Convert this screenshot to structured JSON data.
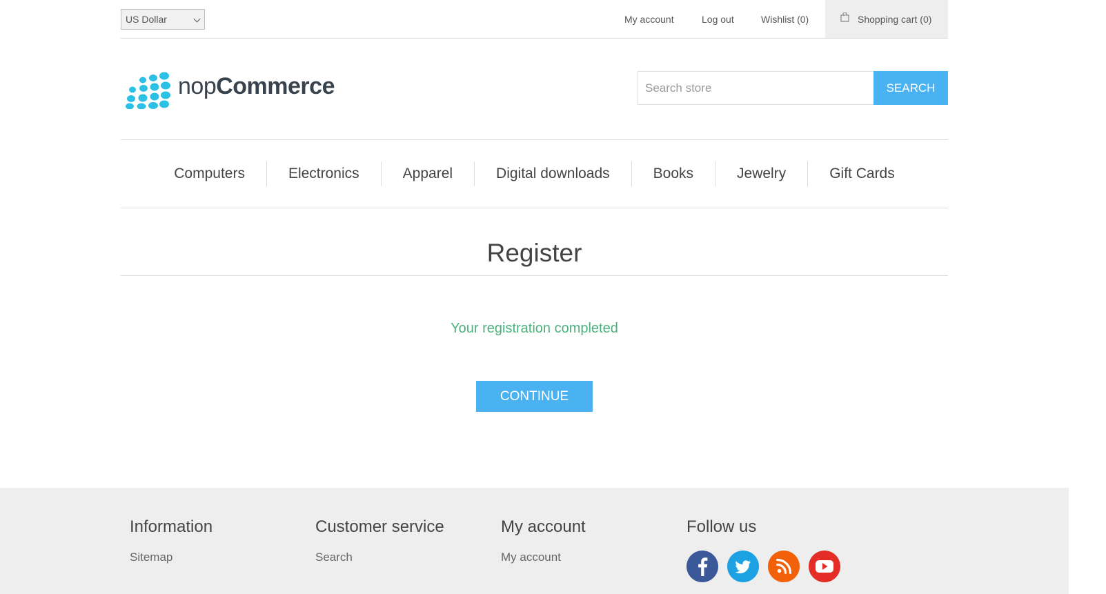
{
  "header": {
    "currency": {
      "selected": "US Dollar"
    },
    "links": {
      "my_account": "My account",
      "log_out": "Log out",
      "wishlist": "Wishlist (0)",
      "shopping_cart": "Shopping cart (0)"
    }
  },
  "logo": {
    "part1": "nop",
    "part2": "Commerce"
  },
  "search": {
    "placeholder": "Search store",
    "button": "Search"
  },
  "menu": {
    "items": [
      "Computers",
      "Electronics",
      "Apparel",
      "Digital downloads",
      "Books",
      "Jewelry",
      "Gift Cards"
    ]
  },
  "page": {
    "title": "Register",
    "result": "Your registration completed",
    "continue": "Continue"
  },
  "footer": {
    "information": {
      "title": "Information",
      "first_link": "Sitemap"
    },
    "customer_service": {
      "title": "Customer service",
      "first_link": "Search"
    },
    "my_account": {
      "title": "My account",
      "first_link": "My account"
    },
    "follow_us": {
      "title": "Follow us",
      "icons": [
        "facebook-icon",
        "twitter-icon",
        "rss-icon",
        "youtube-icon"
      ]
    }
  },
  "colors": {
    "accent": "#4ab2f1",
    "success": "#4cb17c",
    "logo_dots": "#2bc0e4",
    "footer_bg": "#eeeeee"
  }
}
